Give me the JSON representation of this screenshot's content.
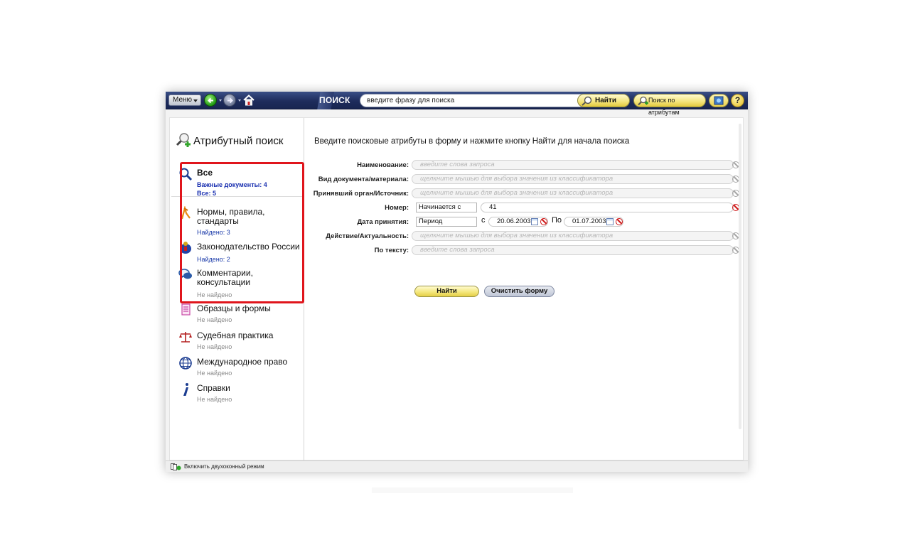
{
  "toolbar": {
    "menu_label": "Меню",
    "search_label": "ПОИСК",
    "search_placeholder": "введите фразу для поиска",
    "find_label": "Найти",
    "attr_search_label": "Поиск по атрибутам",
    "help_label": "?"
  },
  "left_pane": {
    "title": "Атрибутный поиск",
    "categories": [
      {
        "label": "Все",
        "sub1": "Важные документы: 4",
        "sub2": "Все: 5",
        "icon": "magnifier-icon"
      },
      {
        "label": "Нормы, правила, стандарты",
        "sub": "Найдено: 3",
        "icon": "compass-icon"
      },
      {
        "label": "Законодательство России",
        "sub": "Найдено: 2",
        "icon": "russian-eagle-icon"
      },
      {
        "label": "Комментарии, консультации",
        "sub": "Не найдено",
        "icon": "speech-bubbles-icon"
      },
      {
        "label": "Образцы и формы",
        "sub": "Не найдено",
        "icon": "form-icon"
      },
      {
        "label": "Судебная практика",
        "sub": "Не найдено",
        "icon": "scales-icon"
      },
      {
        "label": "Международное право",
        "sub": "Не найдено",
        "icon": "globe-icon"
      },
      {
        "label": "Справки",
        "sub": "Не найдено",
        "icon": "info-icon"
      }
    ]
  },
  "form": {
    "prompt": "Введите поисковые атрибуты в форму и нажмите кнопку Найти для начала поиска",
    "fields": {
      "name": {
        "label": "Наименование:",
        "placeholder": "введите слова запроса"
      },
      "doc_type": {
        "label": "Вид документа/материала:",
        "placeholder": "щелкните мышью для выбора значения из классификатора"
      },
      "issuer": {
        "label": "Принявший орган/Источник:",
        "placeholder": "щелкните мышью для выбора значения из классификатора"
      },
      "number": {
        "label": "Номер:",
        "mode": "Начинается с",
        "value": "41"
      },
      "date": {
        "label": "Дата принятия:",
        "mode": "Период",
        "from_label": "с",
        "from": "20.06.2003",
        "to_label": "По",
        "to": "01.07.2003"
      },
      "status": {
        "label": "Действие/Актуальность:",
        "placeholder": "щелкните мышью для выбора значения из классификатора"
      },
      "text": {
        "label": "По тексту:",
        "placeholder": "введите слова запроса"
      }
    },
    "find_button": "Найти",
    "clear_button": "Очистить форму"
  },
  "statusbar": {
    "dual_window_label": "Включить двухоконный режим"
  }
}
